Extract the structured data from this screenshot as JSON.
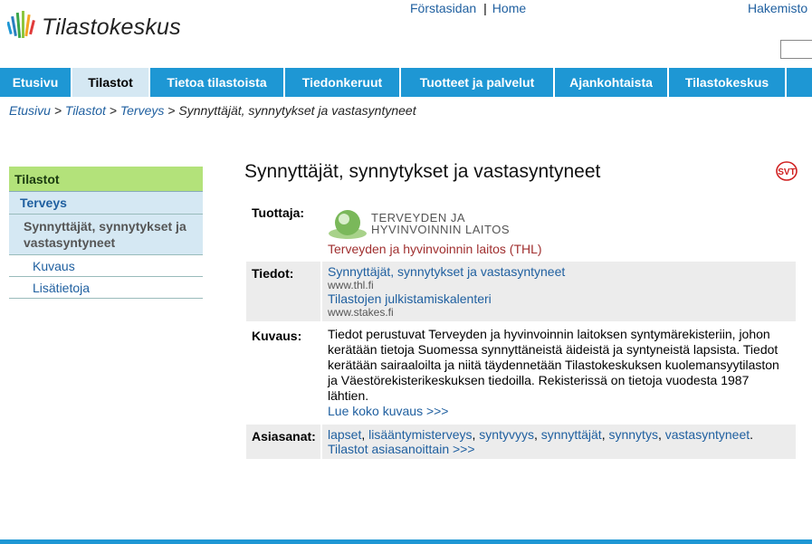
{
  "header": {
    "logo_text": "Tilastokeskus",
    "toplinks": [
      "Förstasidan",
      "Home"
    ],
    "toplinks_separator": "|",
    "hakemisto": "Hakemisto"
  },
  "nav": {
    "items": [
      "Etusivu",
      "Tilastot",
      "Tietoa tilastoista",
      "Tiedonkeruut",
      "Tuotteet ja palvelut",
      "Ajankohtaista",
      "Tilastokeskus"
    ],
    "active": "Tilastot"
  },
  "breadcrumb": {
    "items": [
      "Etusivu",
      "Tilastot",
      "Terveys"
    ],
    "separator": ">",
    "current": "Synnyttäjät, synnytykset ja vastasyntyneet"
  },
  "sidebar": {
    "top": "Tilastot",
    "level1": "Terveys",
    "level2": "Synnyttäjät, synnytykset ja vastasyntyneet",
    "level3": [
      "Kuvaus",
      "Lisätietoja"
    ]
  },
  "main": {
    "title": "Synnyttäjät, synnytykset ja vastasyntyneet",
    "producer_label": "Tuottaja:",
    "producer_logo_line1": "TERVEYDEN JA",
    "producer_logo_line2": "HYVINVOINNIN LAITOS",
    "producer_name": "Terveyden ja hyvinvoinnin laitos (THL)",
    "data_label": "Tiedot:",
    "data_links": [
      {
        "title": "Synnyttäjät, synnytykset ja vastasyntyneet",
        "url": "www.thl.fi"
      },
      {
        "title": "Tilastojen julkistamiskalenteri",
        "url": "www.stakes.fi"
      }
    ],
    "description_label": "Kuvaus:",
    "description": "Tiedot perustuvat Terveyden ja hyvinvoinnin laitoksen syntymärekisteriin, johon kerätään tietoja Suomessa synnyttäneistä äideistä ja syntyneistä lapsista. Tiedot kerätään sairaaloilta ja niitä täydennetään Tilastokeskuksen kuolemansyytilaston ja Väestörekisterikeskuksen tiedoilla. Rekisterissä on tietoja vuodesta 1987 lähtien.",
    "description_more": "Lue koko kuvaus >>>",
    "keywords_label": "Asiasanat:",
    "keywords": [
      "lapset",
      "lisääntymisterveys",
      "syntyvyys",
      "synnyttäjät",
      "synnytys",
      "vastasyntyneet"
    ],
    "keywords_more": "Tilastot asiasanoittain >>>",
    "svt_badge": "SVT"
  },
  "colors": {
    "nav_blue": "#1e97d4",
    "active_tab": "#d5e8f3",
    "sidebar_green": "#b3e27a",
    "link_blue": "#2060a0",
    "thl_red": "#a03030"
  }
}
